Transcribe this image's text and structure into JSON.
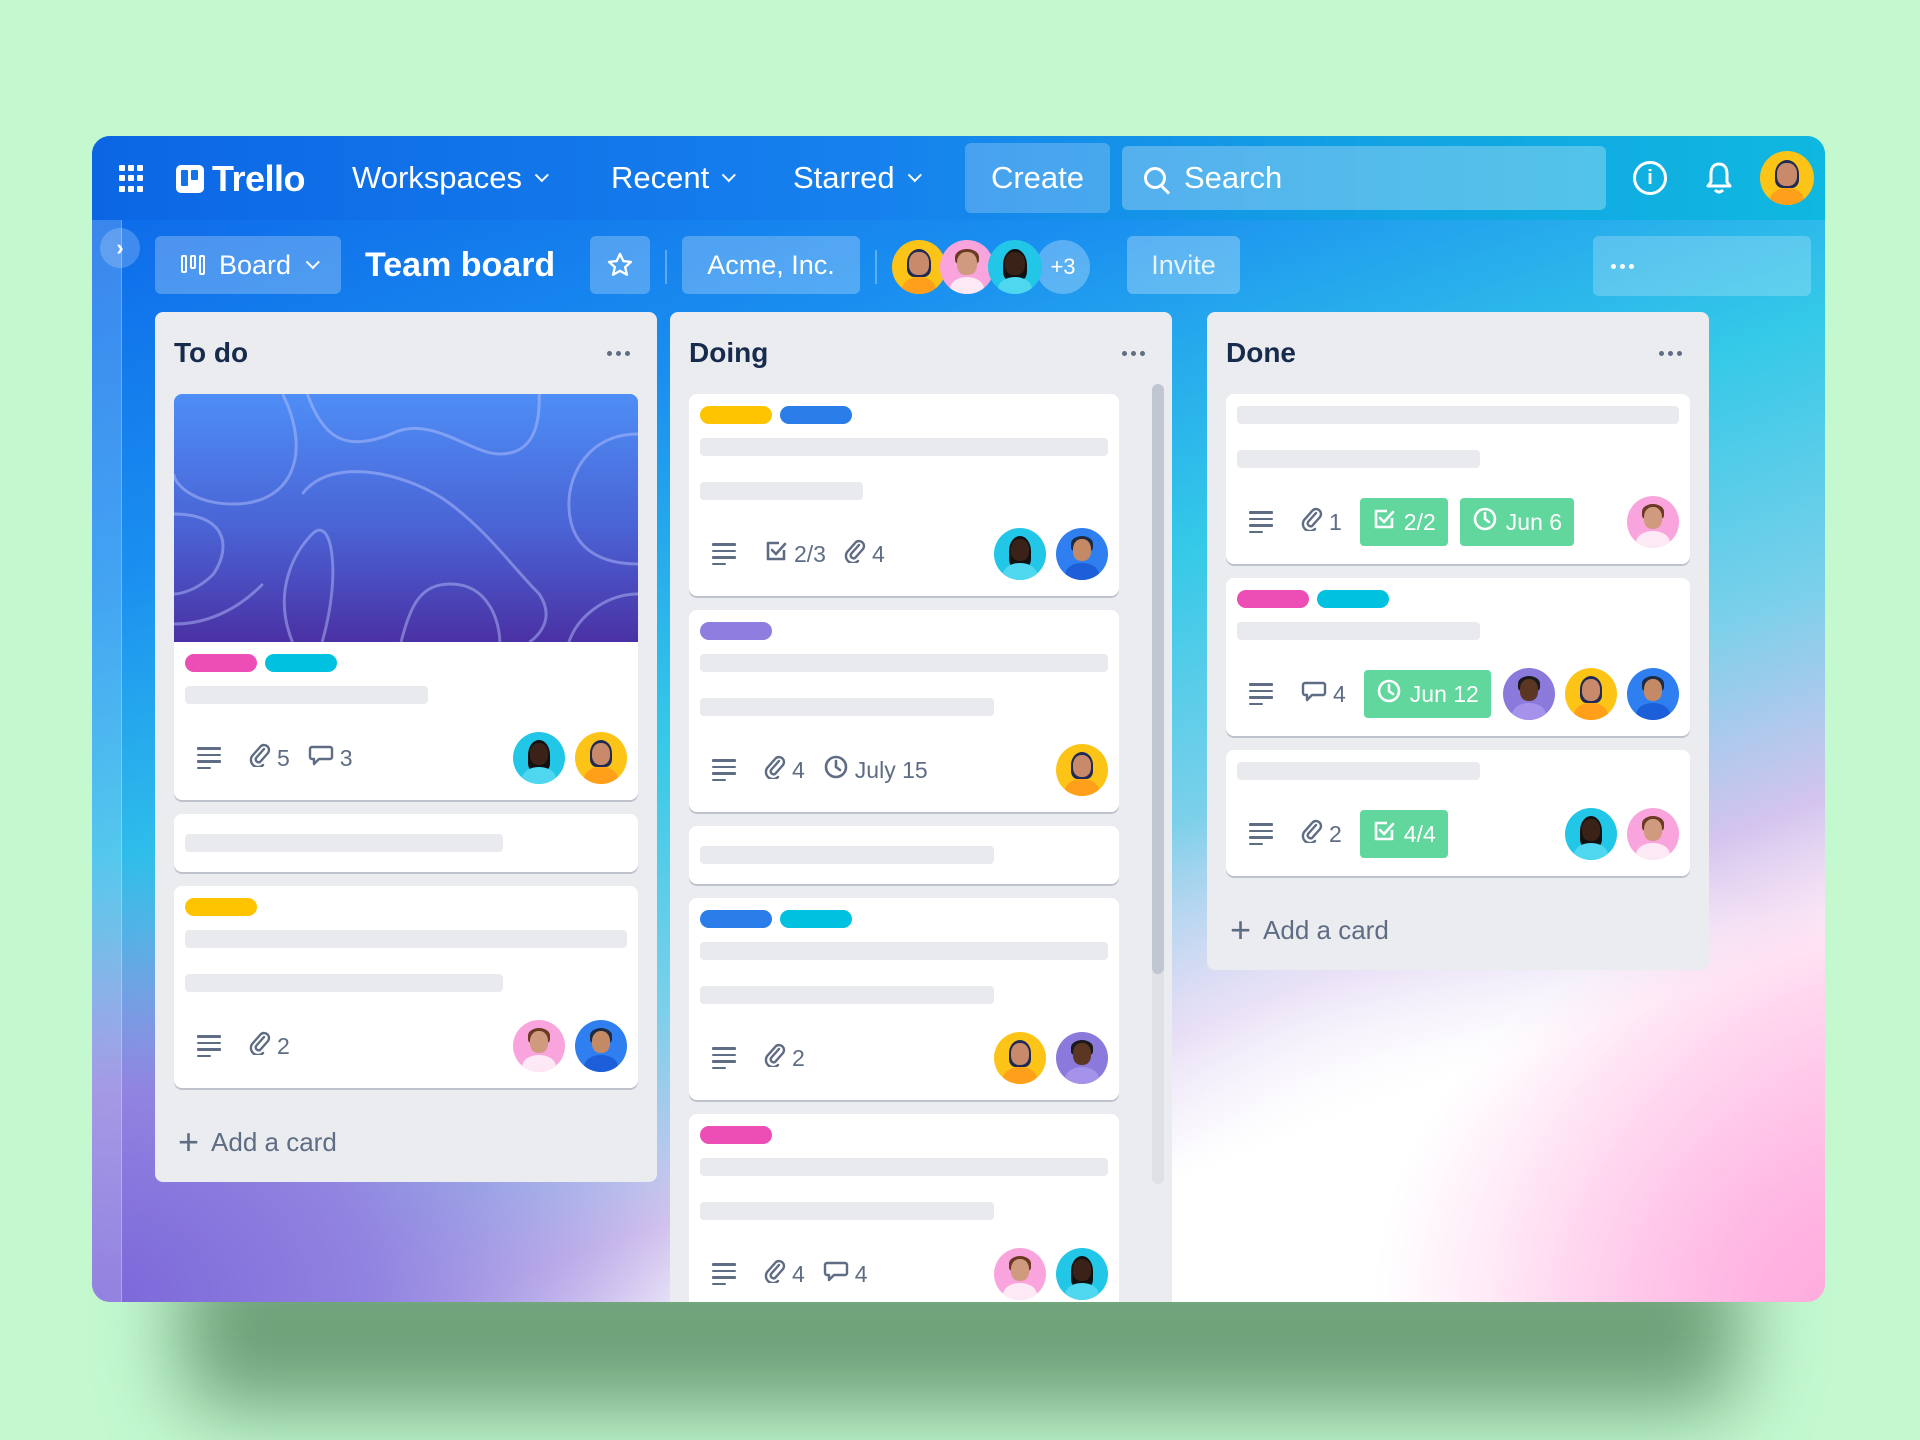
{
  "colors": {
    "page_background": "#c4f9d0",
    "topbar": "#0c66e4",
    "list_background": "#ebecf0",
    "badge_done": "#61d69d",
    "label_pink": "#ec4eb5",
    "label_cyan": "#00c2e0",
    "label_yellow": "#ffc400",
    "label_blue": "#2b7de9",
    "label_purple": "#8f7ee0"
  },
  "topbar": {
    "app_name": "Trello",
    "nav": [
      {
        "label": "Workspaces"
      },
      {
        "label": "Recent"
      },
      {
        "label": "Starred"
      }
    ],
    "create_label": "Create",
    "search_placeholder": "Search",
    "info_icon": "info-icon",
    "bell_icon": "bell-icon"
  },
  "board_header": {
    "view_label": "Board",
    "title": "Team board",
    "workspace": "Acme, Inc.",
    "extra_members": "+3",
    "invite_label": "Invite"
  },
  "lists": [
    {
      "title": "To do",
      "add_card": "Add a card",
      "cards": [
        {
          "cover": true,
          "labels": [
            "pink",
            "cyan"
          ],
          "attachments": "5",
          "comments": "3",
          "members": [
            "teal",
            "yellow"
          ]
        },
        {
          "placeholder_only": true
        },
        {
          "labels": [
            "yellow"
          ],
          "attachments": "2",
          "members": [
            "pink",
            "blue"
          ]
        }
      ]
    },
    {
      "title": "Doing",
      "add_card": "Add a card",
      "cards": [
        {
          "labels": [
            "yellow",
            "blue"
          ],
          "checklist": "2/3",
          "attachments": "4",
          "members": [
            "teal",
            "blue"
          ]
        },
        {
          "labels": [
            "purple"
          ],
          "attachments": "4",
          "due": "July 15",
          "members": [
            "yellow"
          ]
        },
        {
          "placeholder_only": true
        },
        {
          "labels": [
            "blue",
            "cyan"
          ],
          "attachments": "2",
          "members": [
            "yellow",
            "purple"
          ]
        },
        {
          "labels": [
            "pink"
          ],
          "attachments": "4",
          "comments": "4",
          "members": [
            "pink",
            "teal"
          ]
        }
      ]
    },
    {
      "title": "Done",
      "add_card": "Add a card",
      "cards": [
        {
          "attachments": "1",
          "checklist_badge": "2/2",
          "due_badge": "Jun 6",
          "members": [
            "pink"
          ]
        },
        {
          "labels": [
            "pink",
            "cyan"
          ],
          "comments": "4",
          "due_badge": "Jun 12",
          "members": [
            "purple",
            "yellow",
            "blue"
          ]
        },
        {
          "attachments": "2",
          "checklist_badge": "4/4",
          "members": [
            "teal",
            "pink"
          ]
        }
      ]
    }
  ]
}
